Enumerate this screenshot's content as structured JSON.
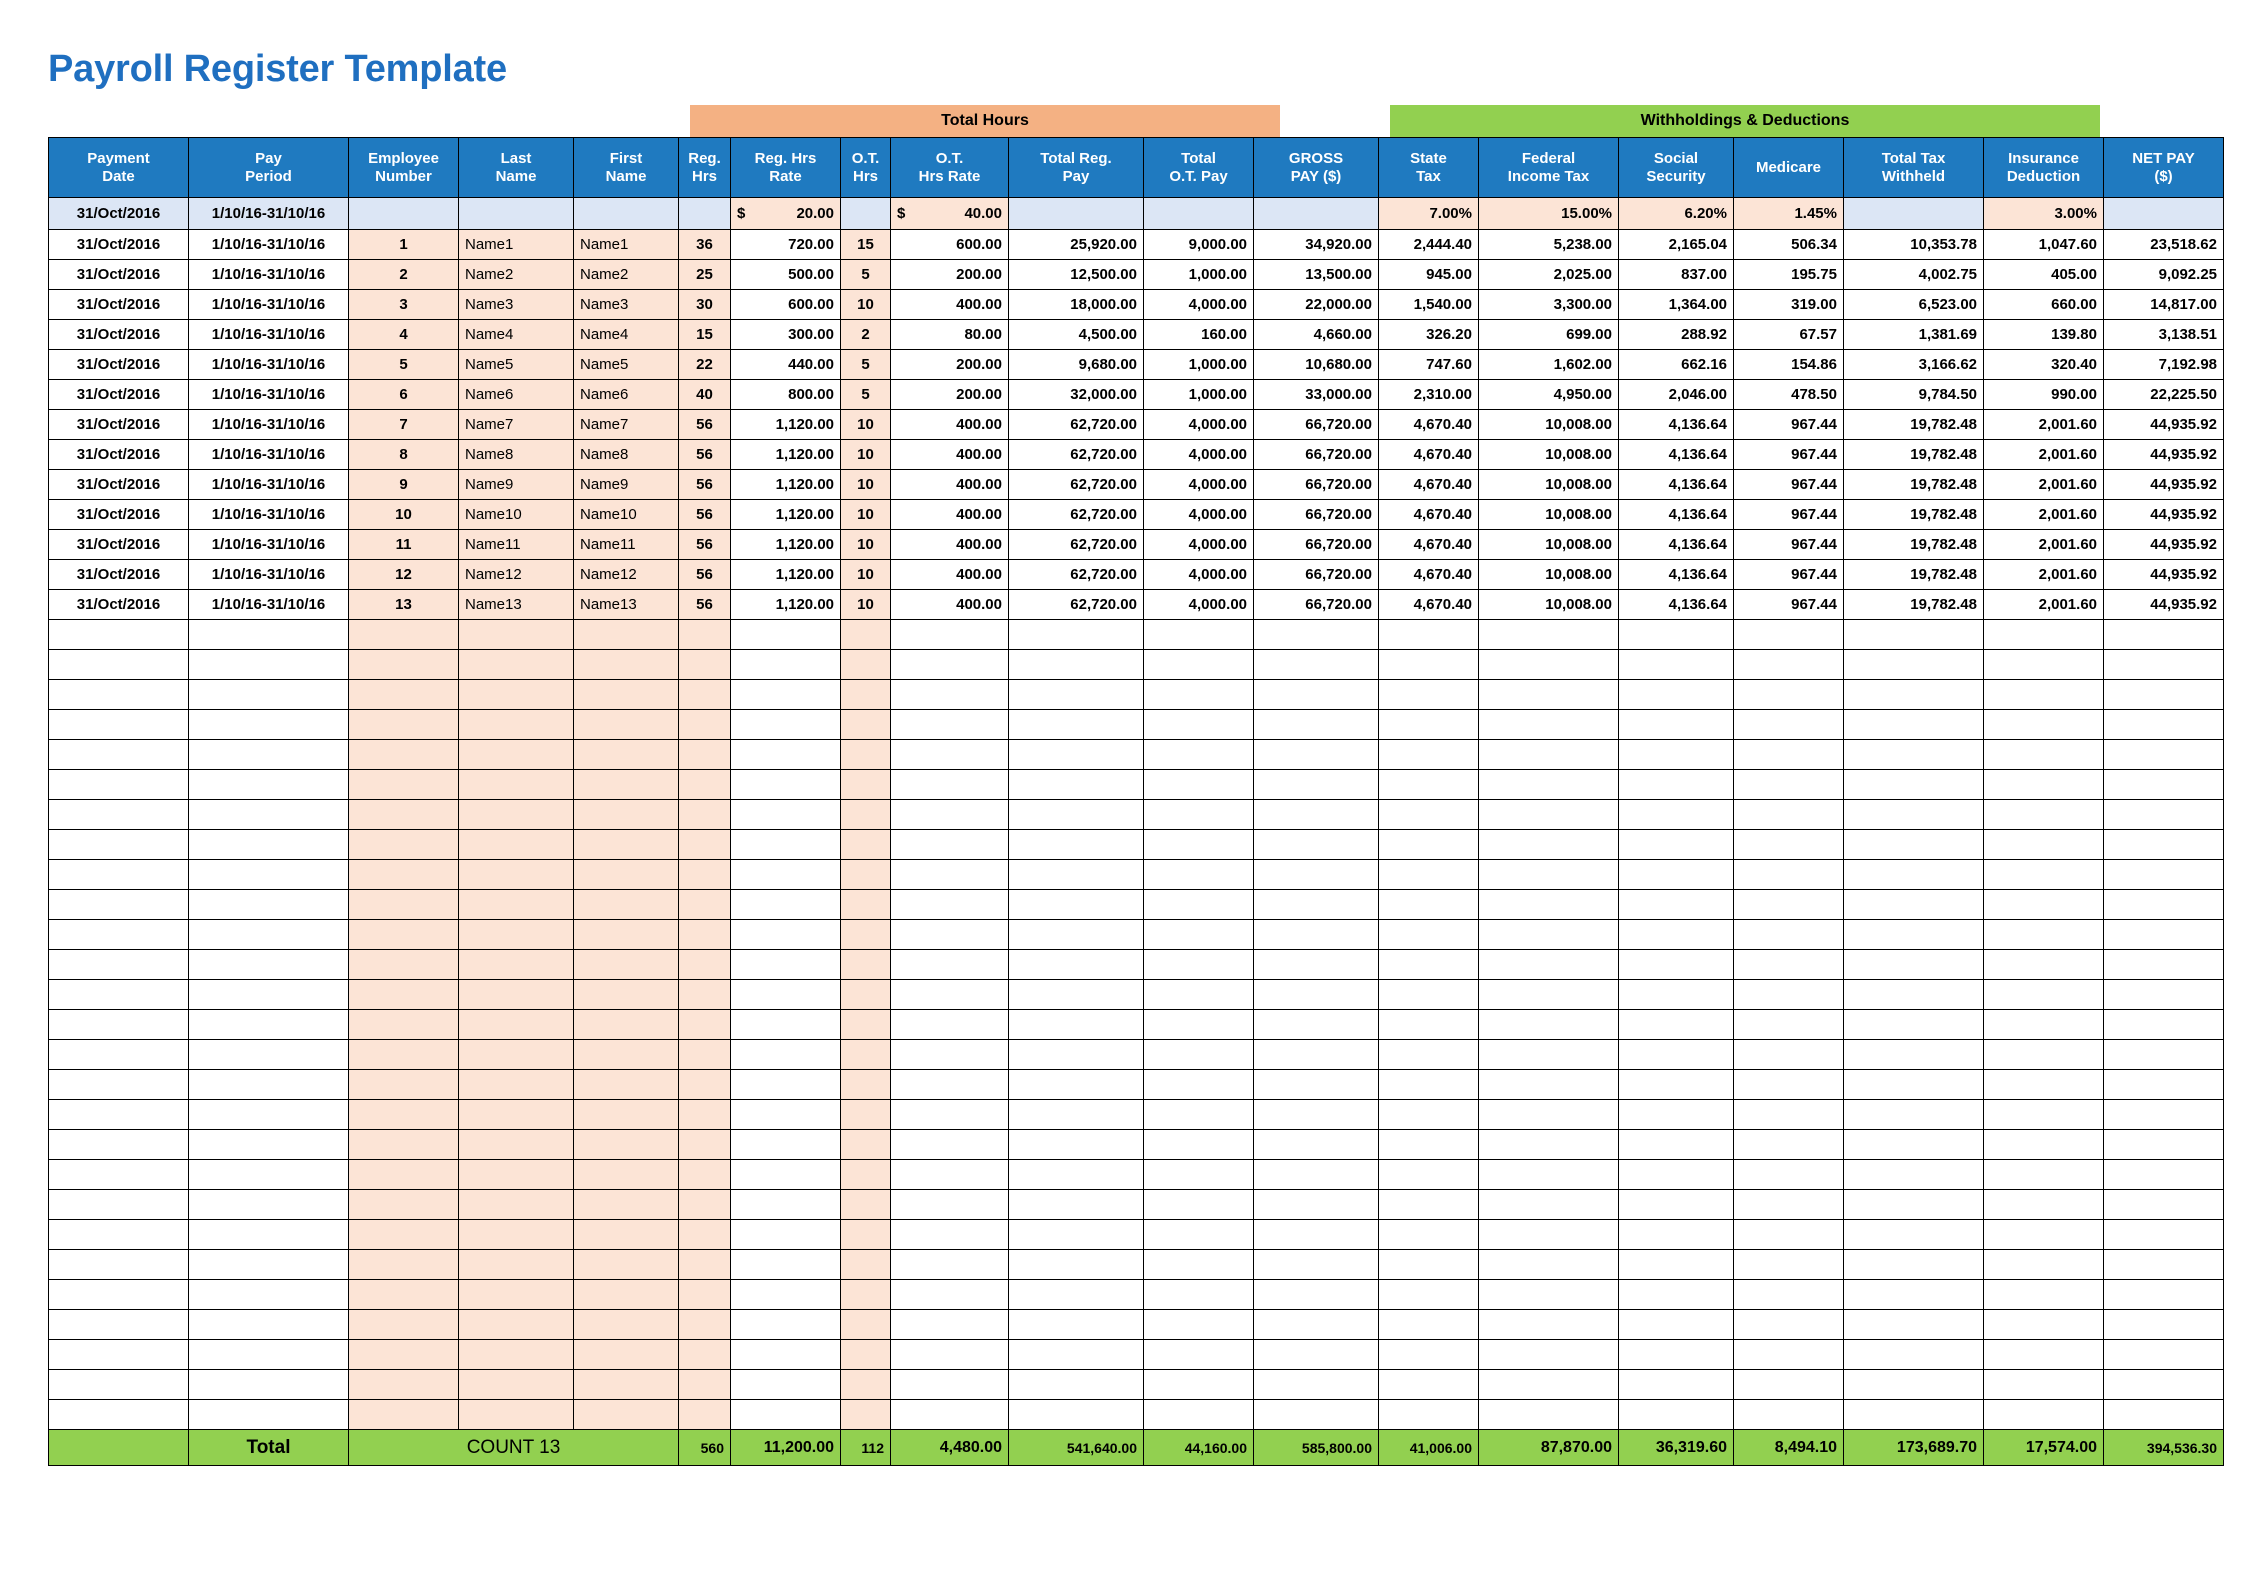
{
  "page": {
    "title": "Payroll Register Template",
    "title_color": "#1f6fc0"
  },
  "banners": {
    "total_hours": "Total Hours",
    "withholdings": "Withholdings & Deductions",
    "total_hours_color": "#f4b183",
    "withholdings_color": "#92d050"
  },
  "columns": [
    {
      "l1": "Payment",
      "l2": "Date"
    },
    {
      "l1": "Pay",
      "l2": "Period"
    },
    {
      "l1": "Employee",
      "l2": "Number"
    },
    {
      "l1": "Last",
      "l2": "Name"
    },
    {
      "l1": "First",
      "l2": "Name"
    },
    {
      "l1": "Reg.",
      "l2": "Hrs"
    },
    {
      "l1": "Reg. Hrs",
      "l2": "Rate"
    },
    {
      "l1": "O.T.",
      "l2": "Hrs"
    },
    {
      "l1": "O.T.",
      "l2": "Hrs Rate"
    },
    {
      "l1": "Total Reg.",
      "l2": "Pay"
    },
    {
      "l1": "Total",
      "l2": "O.T. Pay"
    },
    {
      "l1": "GROSS",
      "l2": "PAY ($)"
    },
    {
      "l1": "State",
      "l2": "Tax"
    },
    {
      "l1": "Federal",
      "l2": "Income Tax"
    },
    {
      "l1": "Social",
      "l2": "Security"
    },
    {
      "l1": "Medicare",
      "l2": ""
    },
    {
      "l1": "Total Tax",
      "l2": "Withheld"
    },
    {
      "l1": "Insurance",
      "l2": "Deduction"
    },
    {
      "l1": "NET PAY",
      "l2": "($)"
    }
  ],
  "rate_row": {
    "payment_date": "31/Oct/2016",
    "pay_period": "1/10/16-31/10/16",
    "employee_number": "",
    "last_name": "",
    "first_name": "",
    "reg_hrs": "",
    "reg_hrs_rate_symbol": "$",
    "reg_hrs_rate": "20.00",
    "ot_hrs": "",
    "ot_hrs_rate_symbol": "$",
    "ot_hrs_rate": "40.00",
    "total_reg_pay": "",
    "total_ot_pay": "",
    "gross_pay": "",
    "state_tax": "7.00%",
    "federal_income_tax": "15.00%",
    "social_security": "6.20%",
    "medicare": "1.45%",
    "total_tax_withheld": "",
    "insurance_deduction": "3.00%",
    "net_pay": ""
  },
  "rows": [
    {
      "payment_date": "31/Oct/2016",
      "pay_period": "1/10/16-31/10/16",
      "employee_number": "1",
      "last_name": "Name1",
      "first_name": "Name1",
      "reg_hrs": "36",
      "reg_hrs_rate": "720.00",
      "ot_hrs": "15",
      "ot_hrs_rate": "600.00",
      "total_reg_pay": "25,920.00",
      "total_ot_pay": "9,000.00",
      "gross_pay": "34,920.00",
      "state_tax": "2,444.40",
      "federal_income_tax": "5,238.00",
      "social_security": "2,165.04",
      "medicare": "506.34",
      "total_tax_withheld": "10,353.78",
      "insurance_deduction": "1,047.60",
      "net_pay": "23,518.62"
    },
    {
      "payment_date": "31/Oct/2016",
      "pay_period": "1/10/16-31/10/16",
      "employee_number": "2",
      "last_name": "Name2",
      "first_name": "Name2",
      "reg_hrs": "25",
      "reg_hrs_rate": "500.00",
      "ot_hrs": "5",
      "ot_hrs_rate": "200.00",
      "total_reg_pay": "12,500.00",
      "total_ot_pay": "1,000.00",
      "gross_pay": "13,500.00",
      "state_tax": "945.00",
      "federal_income_tax": "2,025.00",
      "social_security": "837.00",
      "medicare": "195.75",
      "total_tax_withheld": "4,002.75",
      "insurance_deduction": "405.00",
      "net_pay": "9,092.25"
    },
    {
      "payment_date": "31/Oct/2016",
      "pay_period": "1/10/16-31/10/16",
      "employee_number": "3",
      "last_name": "Name3",
      "first_name": "Name3",
      "reg_hrs": "30",
      "reg_hrs_rate": "600.00",
      "ot_hrs": "10",
      "ot_hrs_rate": "400.00",
      "total_reg_pay": "18,000.00",
      "total_ot_pay": "4,000.00",
      "gross_pay": "22,000.00",
      "state_tax": "1,540.00",
      "federal_income_tax": "3,300.00",
      "social_security": "1,364.00",
      "medicare": "319.00",
      "total_tax_withheld": "6,523.00",
      "insurance_deduction": "660.00",
      "net_pay": "14,817.00"
    },
    {
      "payment_date": "31/Oct/2016",
      "pay_period": "1/10/16-31/10/16",
      "employee_number": "4",
      "last_name": "Name4",
      "first_name": "Name4",
      "reg_hrs": "15",
      "reg_hrs_rate": "300.00",
      "ot_hrs": "2",
      "ot_hrs_rate": "80.00",
      "total_reg_pay": "4,500.00",
      "total_ot_pay": "160.00",
      "gross_pay": "4,660.00",
      "state_tax": "326.20",
      "federal_income_tax": "699.00",
      "social_security": "288.92",
      "medicare": "67.57",
      "total_tax_withheld": "1,381.69",
      "insurance_deduction": "139.80",
      "net_pay": "3,138.51"
    },
    {
      "payment_date": "31/Oct/2016",
      "pay_period": "1/10/16-31/10/16",
      "employee_number": "5",
      "last_name": "Name5",
      "first_name": "Name5",
      "reg_hrs": "22",
      "reg_hrs_rate": "440.00",
      "ot_hrs": "5",
      "ot_hrs_rate": "200.00",
      "total_reg_pay": "9,680.00",
      "total_ot_pay": "1,000.00",
      "gross_pay": "10,680.00",
      "state_tax": "747.60",
      "federal_income_tax": "1,602.00",
      "social_security": "662.16",
      "medicare": "154.86",
      "total_tax_withheld": "3,166.62",
      "insurance_deduction": "320.40",
      "net_pay": "7,192.98"
    },
    {
      "payment_date": "31/Oct/2016",
      "pay_period": "1/10/16-31/10/16",
      "employee_number": "6",
      "last_name": "Name6",
      "first_name": "Name6",
      "reg_hrs": "40",
      "reg_hrs_rate": "800.00",
      "ot_hrs": "5",
      "ot_hrs_rate": "200.00",
      "total_reg_pay": "32,000.00",
      "total_ot_pay": "1,000.00",
      "gross_pay": "33,000.00",
      "state_tax": "2,310.00",
      "federal_income_tax": "4,950.00",
      "social_security": "2,046.00",
      "medicare": "478.50",
      "total_tax_withheld": "9,784.50",
      "insurance_deduction": "990.00",
      "net_pay": "22,225.50"
    },
    {
      "payment_date": "31/Oct/2016",
      "pay_period": "1/10/16-31/10/16",
      "employee_number": "7",
      "last_name": "Name7",
      "first_name": "Name7",
      "reg_hrs": "56",
      "reg_hrs_rate": "1,120.00",
      "ot_hrs": "10",
      "ot_hrs_rate": "400.00",
      "total_reg_pay": "62,720.00",
      "total_ot_pay": "4,000.00",
      "gross_pay": "66,720.00",
      "state_tax": "4,670.40",
      "federal_income_tax": "10,008.00",
      "social_security": "4,136.64",
      "medicare": "967.44",
      "total_tax_withheld": "19,782.48",
      "insurance_deduction": "2,001.60",
      "net_pay": "44,935.92"
    },
    {
      "payment_date": "31/Oct/2016",
      "pay_period": "1/10/16-31/10/16",
      "employee_number": "8",
      "last_name": "Name8",
      "first_name": "Name8",
      "reg_hrs": "56",
      "reg_hrs_rate": "1,120.00",
      "ot_hrs": "10",
      "ot_hrs_rate": "400.00",
      "total_reg_pay": "62,720.00",
      "total_ot_pay": "4,000.00",
      "gross_pay": "66,720.00",
      "state_tax": "4,670.40",
      "federal_income_tax": "10,008.00",
      "social_security": "4,136.64",
      "medicare": "967.44",
      "total_tax_withheld": "19,782.48",
      "insurance_deduction": "2,001.60",
      "net_pay": "44,935.92"
    },
    {
      "payment_date": "31/Oct/2016",
      "pay_period": "1/10/16-31/10/16",
      "employee_number": "9",
      "last_name": "Name9",
      "first_name": "Name9",
      "reg_hrs": "56",
      "reg_hrs_rate": "1,120.00",
      "ot_hrs": "10",
      "ot_hrs_rate": "400.00",
      "total_reg_pay": "62,720.00",
      "total_ot_pay": "4,000.00",
      "gross_pay": "66,720.00",
      "state_tax": "4,670.40",
      "federal_income_tax": "10,008.00",
      "social_security": "4,136.64",
      "medicare": "967.44",
      "total_tax_withheld": "19,782.48",
      "insurance_deduction": "2,001.60",
      "net_pay": "44,935.92"
    },
    {
      "payment_date": "31/Oct/2016",
      "pay_period": "1/10/16-31/10/16",
      "employee_number": "10",
      "last_name": "Name10",
      "first_name": "Name10",
      "reg_hrs": "56",
      "reg_hrs_rate": "1,120.00",
      "ot_hrs": "10",
      "ot_hrs_rate": "400.00",
      "total_reg_pay": "62,720.00",
      "total_ot_pay": "4,000.00",
      "gross_pay": "66,720.00",
      "state_tax": "4,670.40",
      "federal_income_tax": "10,008.00",
      "social_security": "4,136.64",
      "medicare": "967.44",
      "total_tax_withheld": "19,782.48",
      "insurance_deduction": "2,001.60",
      "net_pay": "44,935.92"
    },
    {
      "payment_date": "31/Oct/2016",
      "pay_period": "1/10/16-31/10/16",
      "employee_number": "11",
      "last_name": "Name11",
      "first_name": "Name11",
      "reg_hrs": "56",
      "reg_hrs_rate": "1,120.00",
      "ot_hrs": "10",
      "ot_hrs_rate": "400.00",
      "total_reg_pay": "62,720.00",
      "total_ot_pay": "4,000.00",
      "gross_pay": "66,720.00",
      "state_tax": "4,670.40",
      "federal_income_tax": "10,008.00",
      "social_security": "4,136.64",
      "medicare": "967.44",
      "total_tax_withheld": "19,782.48",
      "insurance_deduction": "2,001.60",
      "net_pay": "44,935.92"
    },
    {
      "payment_date": "31/Oct/2016",
      "pay_period": "1/10/16-31/10/16",
      "employee_number": "12",
      "last_name": "Name12",
      "first_name": "Name12",
      "reg_hrs": "56",
      "reg_hrs_rate": "1,120.00",
      "ot_hrs": "10",
      "ot_hrs_rate": "400.00",
      "total_reg_pay": "62,720.00",
      "total_ot_pay": "4,000.00",
      "gross_pay": "66,720.00",
      "state_tax": "4,670.40",
      "federal_income_tax": "10,008.00",
      "social_security": "4,136.64",
      "medicare": "967.44",
      "total_tax_withheld": "19,782.48",
      "insurance_deduction": "2,001.60",
      "net_pay": "44,935.92"
    },
    {
      "payment_date": "31/Oct/2016",
      "pay_period": "1/10/16-31/10/16",
      "employee_number": "13",
      "last_name": "Name13",
      "first_name": "Name13",
      "reg_hrs": "56",
      "reg_hrs_rate": "1,120.00",
      "ot_hrs": "10",
      "ot_hrs_rate": "400.00",
      "total_reg_pay": "62,720.00",
      "total_ot_pay": "4,000.00",
      "gross_pay": "66,720.00",
      "state_tax": "4,670.40",
      "federal_income_tax": "10,008.00",
      "social_security": "4,136.64",
      "medicare": "967.44",
      "total_tax_withheld": "19,782.48",
      "insurance_deduction": "2,001.60",
      "net_pay": "44,935.92"
    }
  ],
  "empty_row_count": 27,
  "total_row": {
    "label": "Total",
    "count_label": "COUNT  13",
    "reg_hrs": "560",
    "reg_hrs_rate": "11,200.00",
    "ot_hrs": "112",
    "ot_hrs_rate": "4,480.00",
    "total_reg_pay": "541,640.00",
    "total_ot_pay": "44,160.00",
    "gross_pay": "585,800.00",
    "state_tax": "41,006.00",
    "federal_income_tax": "87,870.00",
    "social_security": "36,319.60",
    "medicare": "8,494.10",
    "total_tax_withheld": "173,689.70",
    "insurance_deduction": "17,574.00",
    "net_pay": "394,536.30"
  }
}
